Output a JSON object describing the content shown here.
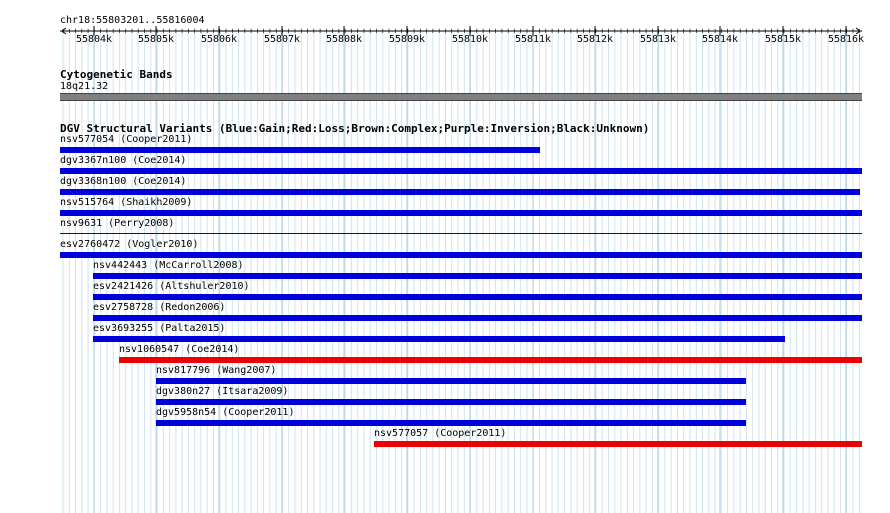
{
  "ruler": {
    "position_label": "chr18:55803201..55816004",
    "ticks": [
      "55804k",
      "55805k",
      "55806k",
      "55807k",
      "55808k",
      "55809k",
      "55810k",
      "55811k",
      "55812k",
      "55813k",
      "55814k",
      "55815k",
      "55816k"
    ]
  },
  "cytoband_track": {
    "title": "Cytogenetic Bands",
    "band_name": "18q21.32"
  },
  "dgv_track": {
    "title": "DGV Structural Variants (Blue:Gain;Red:Loss;Brown:Complex;Purple:Inversion;Black:Unknown)",
    "colors": {
      "gain": "#0000dd",
      "loss": "#ee0000"
    },
    "features": [
      {
        "label": "nsv577054 (Cooper2011)",
        "type": "gain"
      },
      {
        "label": "dgv3367n100 (Coe2014)",
        "type": "gain"
      },
      {
        "label": "dgv3368n100 (Coe2014)",
        "type": "gain"
      },
      {
        "label": "nsv515764 (Shaikh2009)",
        "type": "gain"
      },
      {
        "label": "nsv9631 (Perry2008)",
        "type": "gain"
      },
      {
        "label": "esv2760472 (Vogler2010)",
        "type": "gain"
      },
      {
        "label": "nsv442443 (McCarroll2008)",
        "type": "gain"
      },
      {
        "label": "esv2421426 (Altshuler2010)",
        "type": "gain"
      },
      {
        "label": "esv2758728 (Redon2006)",
        "type": "gain"
      },
      {
        "label": "esv3693255 (Palta2015)",
        "type": "gain"
      },
      {
        "label": "nsv1060547 (Coe2014)",
        "type": "loss"
      },
      {
        "label": "nsv817796 (Wang2007)",
        "type": "gain"
      },
      {
        "label": "dgv380n27 (Itsara2009)",
        "type": "gain"
      },
      {
        "label": "dgv5958n54 (Cooper2011)",
        "type": "gain"
      },
      {
        "label": "nsv577057 (Cooper2011)",
        "type": "loss"
      }
    ]
  }
}
